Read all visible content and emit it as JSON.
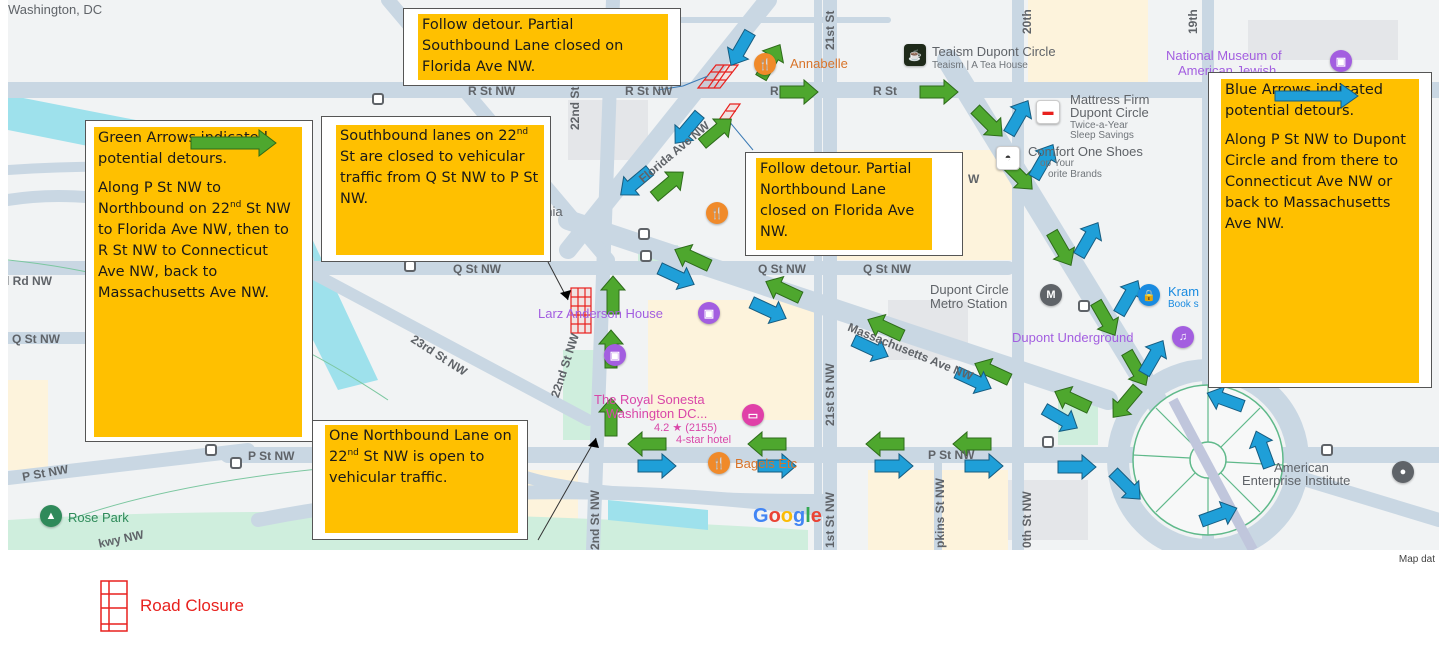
{
  "map": {
    "region_label": "Washington, DC",
    "attribution": "Map dat",
    "google_logo": [
      "G",
      "o",
      "o",
      "g",
      "l",
      "e"
    ],
    "google_colors": [
      "#4285f4",
      "#ea4335",
      "#fbbc05",
      "#4285f4",
      "#34a853",
      "#ea4335"
    ],
    "streets": {
      "r_st_1": "R St NW",
      "r_st_2": "R St NW",
      "r_st_3": "R",
      "r_st_4": "R St",
      "q_st_1": "Q St NW",
      "q_st_2": "Q St NW",
      "q_st_3": "Q St NW",
      "q_st_4": "Q St NW",
      "p_st_1": "P St NW",
      "p_st_2": "P St NW",
      "p_st_3": "P St NW",
      "rd_nw": "l Rd NW",
      "st22_1": "22nd St NW",
      "st22_2": "22nd St NW",
      "st22_3": "2nd St NW",
      "st21_1": "21st St",
      "st21_2": "21st St NW",
      "st21_3": "1st St NW",
      "st20": "20th",
      "st20_b": "0th St NW",
      "st19": "19th",
      "st23": "23rd St NW",
      "florida": "Florida Ave NW",
      "mass": "Massachusetts Ave NW",
      "hopkins": "pkins St NW",
      "pkwy": "kwy NW",
      "w_fragment": "W"
    },
    "pois": {
      "annabelle": "Annabelle",
      "teaism": "Teaism Dupont Circle",
      "teaism_sub": "Teaism | A Tea House",
      "museum": "National Museum of",
      "museum_2": "American Jewish",
      "mattress": "Mattress Firm",
      "mattress_2": "Dupont Circle",
      "mattress_sub1": "Twice-a-Year",
      "mattress_sub2": "Sleep Savings",
      "comfort": "Comfort One Shoes",
      "comfort_sub1": "op Your",
      "comfort_sub2": "orite Brands",
      "ania": "ania",
      "larz": "Larz Anderson House",
      "metro": "Dupont Circle",
      "metro_2": "Metro Station",
      "kramers": "Kram",
      "kramers_sub": "Book s",
      "underground": "Dupont Underground",
      "sonesta": "The Royal Sonesta",
      "sonesta_2": "Washington DC...",
      "sonesta_rating": "4.2 ★ (2155)",
      "sonesta_type": "4-star hotel",
      "bagels": "Bagels Etc",
      "aei": "American",
      "aei_2": "Enterprise Institute",
      "rose_park": "Rose Park"
    }
  },
  "callouts": {
    "southbound_florida": "Follow detour. Partial Southbound Lane closed on Florida Ave NW.",
    "st22_closed": {
      "pre": "Southbound lanes on 22",
      "sup": "nd",
      "post": " St are closed to vehicular traffic from Q St NW to P St NW."
    },
    "northbound_florida": "Follow detour. Partial Northbound Lane closed on Florida Ave NW.",
    "st22_open": {
      "pre": "One Northbound Lane on 22",
      "sup": "nd",
      "post": " St NW is open to vehicular traffic."
    }
  },
  "legend_green": {
    "color": "#4ea72e",
    "title": "Green Arrows indicated potential detours.",
    "body_pre": "Along P St NW to Northbound on 22",
    "body_sup": "nd",
    "body_post": " St NW to Florida Ave NW, then to R St NW to Connecticut Ave NW, back to Massachusetts Ave NW."
  },
  "legend_blue": {
    "color": "#1f9fd8",
    "title": "Blue Arrows indicated potential detours.",
    "body": "Along P St NW to Dupont Circle and from there to Connecticut Ave NW or back to Massachusetts Ave NW."
  },
  "legend_closure": {
    "label": "Road Closure",
    "color": "#e8211e"
  },
  "colors": {
    "callout_fill": "#ffc000",
    "green_arrow": "#4ea72e",
    "blue_arrow": "#1f9fd8",
    "closure": "#e8211e"
  }
}
